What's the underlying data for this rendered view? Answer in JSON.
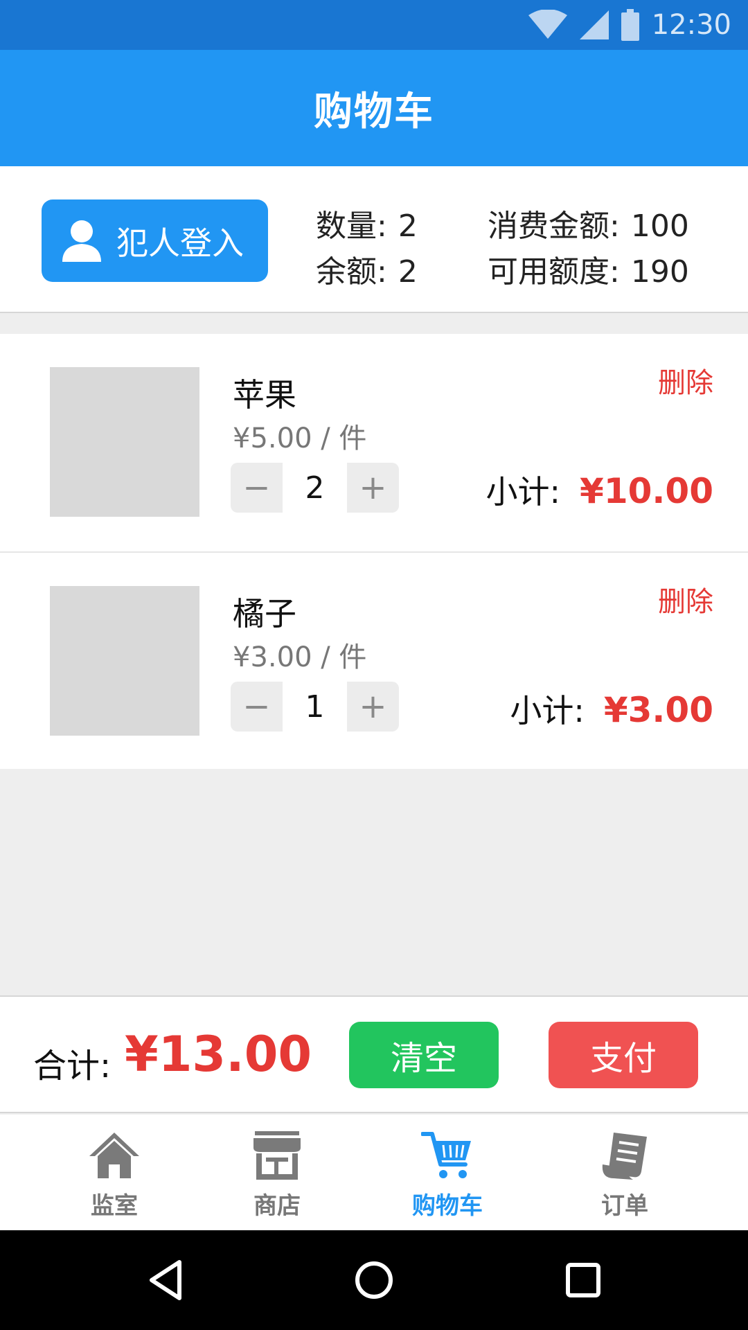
{
  "status_bar": {
    "time": "12:30"
  },
  "app_bar": {
    "title": "购物车"
  },
  "account": {
    "login_label": "犯人登入",
    "stats": [
      {
        "label": "数量:",
        "value": "2"
      },
      {
        "label": "消费金额:",
        "value": "100"
      },
      {
        "label": "余额:",
        "value": "2"
      },
      {
        "label": "可用额度:",
        "value": "190"
      }
    ]
  },
  "cart": {
    "items": [
      {
        "name": "苹果",
        "price": "¥5.00 / 件",
        "quantity": "2",
        "subtotal_label": "小计:",
        "subtotal": "¥10.00",
        "delete_label": "删除",
        "minus": "−",
        "plus": "+"
      },
      {
        "name": "橘子",
        "price": "¥3.00 / 件",
        "quantity": "1",
        "subtotal_label": "小计:",
        "subtotal": "¥3.00",
        "delete_label": "删除",
        "minus": "−",
        "plus": "+"
      }
    ]
  },
  "checkout": {
    "total_label": "合计:",
    "total": "¥13.00",
    "clear_label": "清空",
    "pay_label": "支付"
  },
  "bottom_nav": {
    "items": [
      {
        "label": "监室",
        "icon": "home-icon",
        "active": false
      },
      {
        "label": "商店",
        "icon": "store-icon",
        "active": false
      },
      {
        "label": "购物车",
        "icon": "cart-icon",
        "active": true
      },
      {
        "label": "订单",
        "icon": "receipt-icon",
        "active": false
      }
    ]
  },
  "colors": {
    "primary": "#2196f3",
    "status_bar": "#1976d2",
    "price_red": "#e53935",
    "clear_green": "#22c55e",
    "pay_red": "#f05252"
  }
}
